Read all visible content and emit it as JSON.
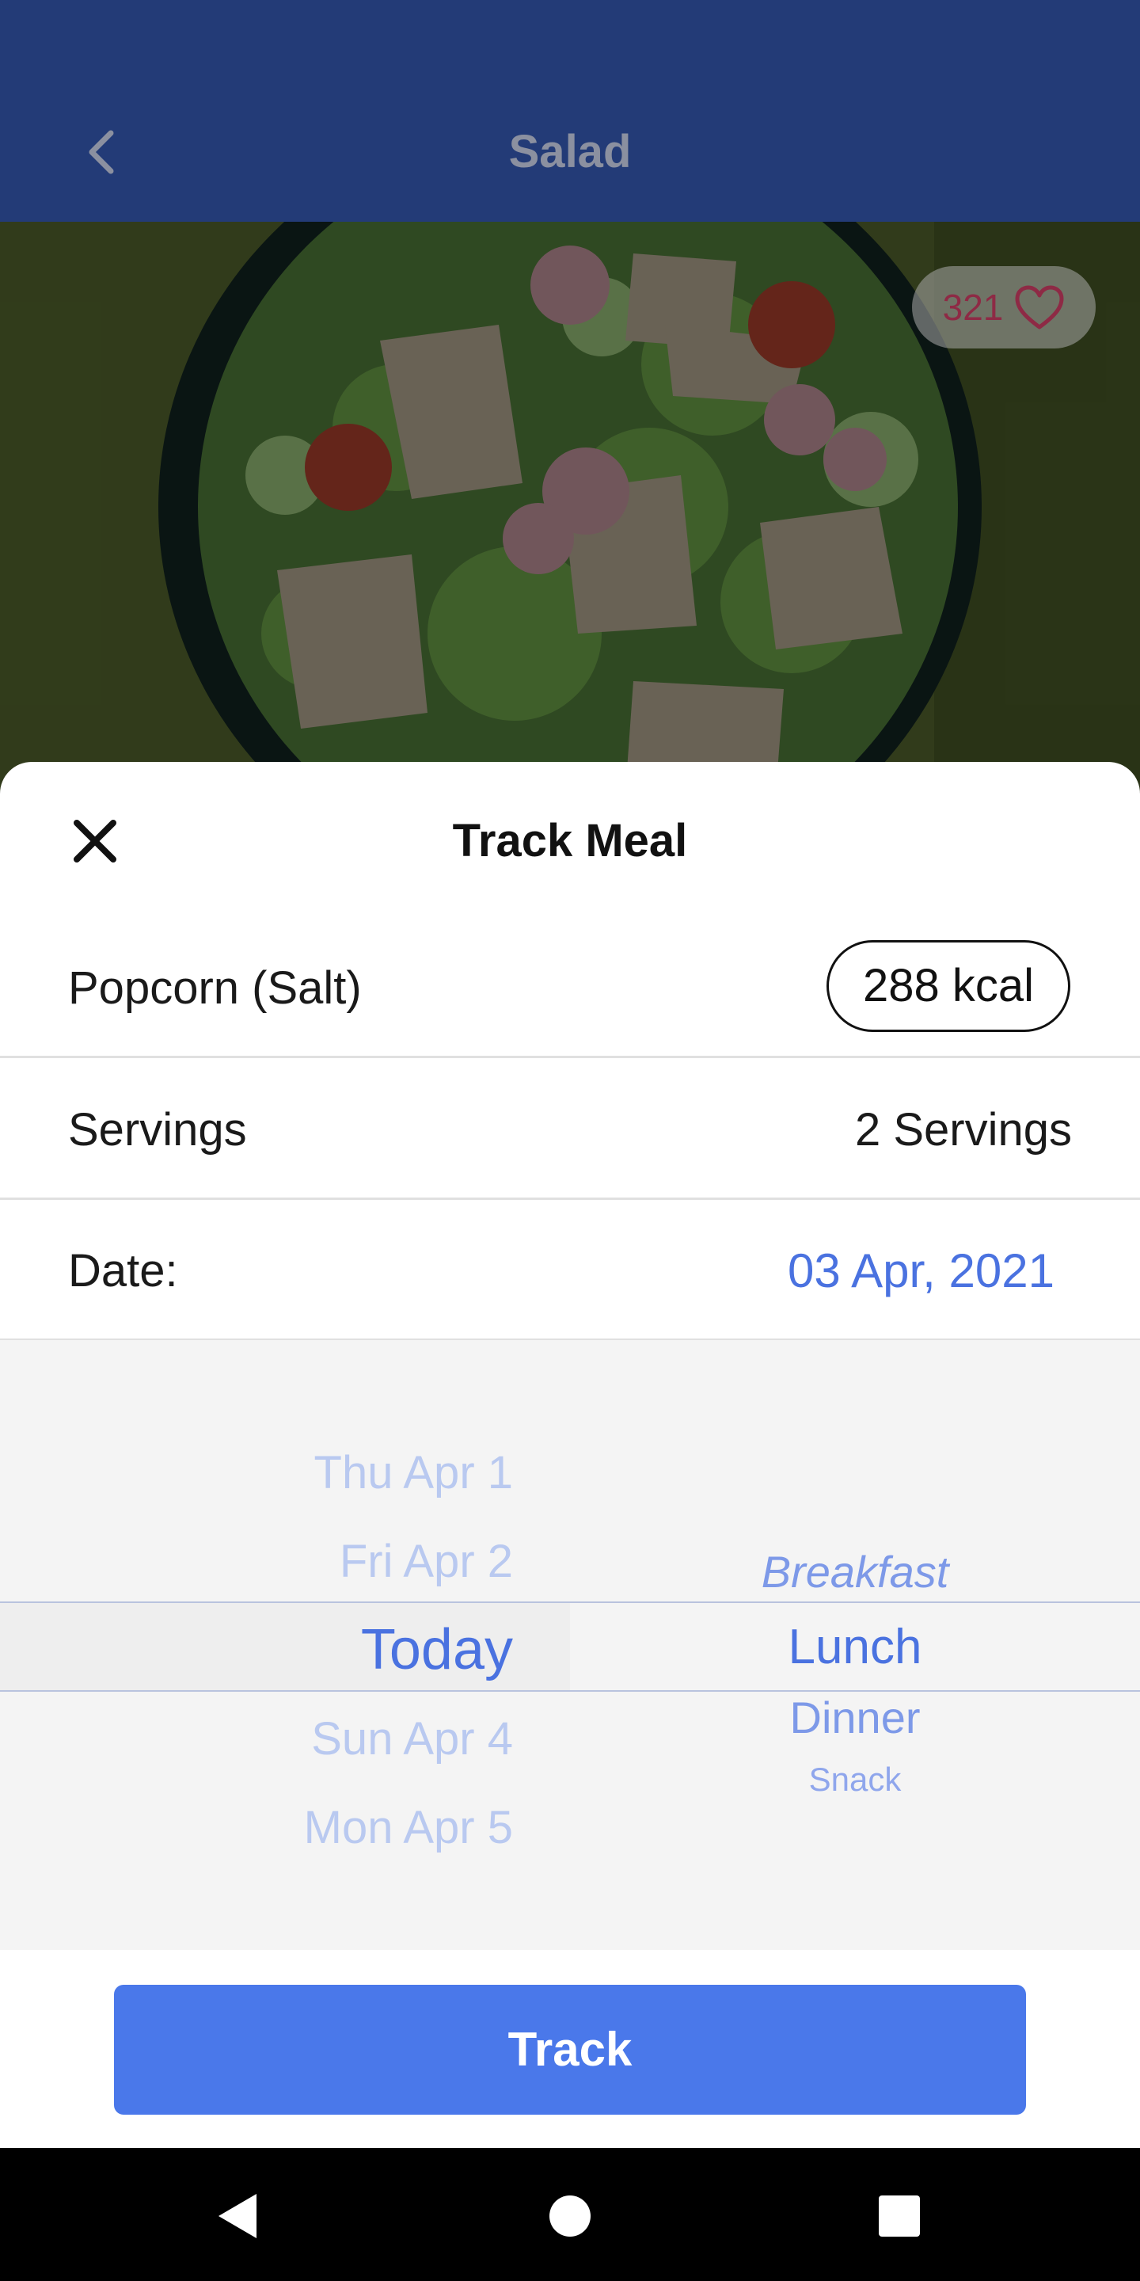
{
  "app_bar": {
    "title": "Salad"
  },
  "hero": {
    "likes": "321"
  },
  "sheet": {
    "title": "Track Meal",
    "food_name": "Popcorn (Salt)",
    "kcal": "288 kcal",
    "servings_label": "Servings",
    "servings_value": "2 Servings",
    "date_label": "Date:",
    "date_value": "03 Apr, 2021"
  },
  "picker": {
    "dates": [
      "Thu Apr 1",
      "Fri Apr 2",
      "Today",
      "Sun Apr 4",
      "Mon Apr 5"
    ],
    "selected_date": "Today",
    "meals": [
      "Breakfast",
      "Lunch",
      "Dinner",
      "Snack"
    ],
    "selected_meal": "Lunch"
  },
  "actions": {
    "track_label": "Track"
  },
  "colors": {
    "app_bar": "#233b77",
    "accent": "#4a78ea",
    "date_text": "#4a72e0",
    "like_text": "#8e2a45"
  },
  "icons": [
    "chevron-left-icon",
    "heart-icon",
    "close-icon",
    "nav-back-icon",
    "nav-home-icon",
    "nav-recents-icon"
  ]
}
